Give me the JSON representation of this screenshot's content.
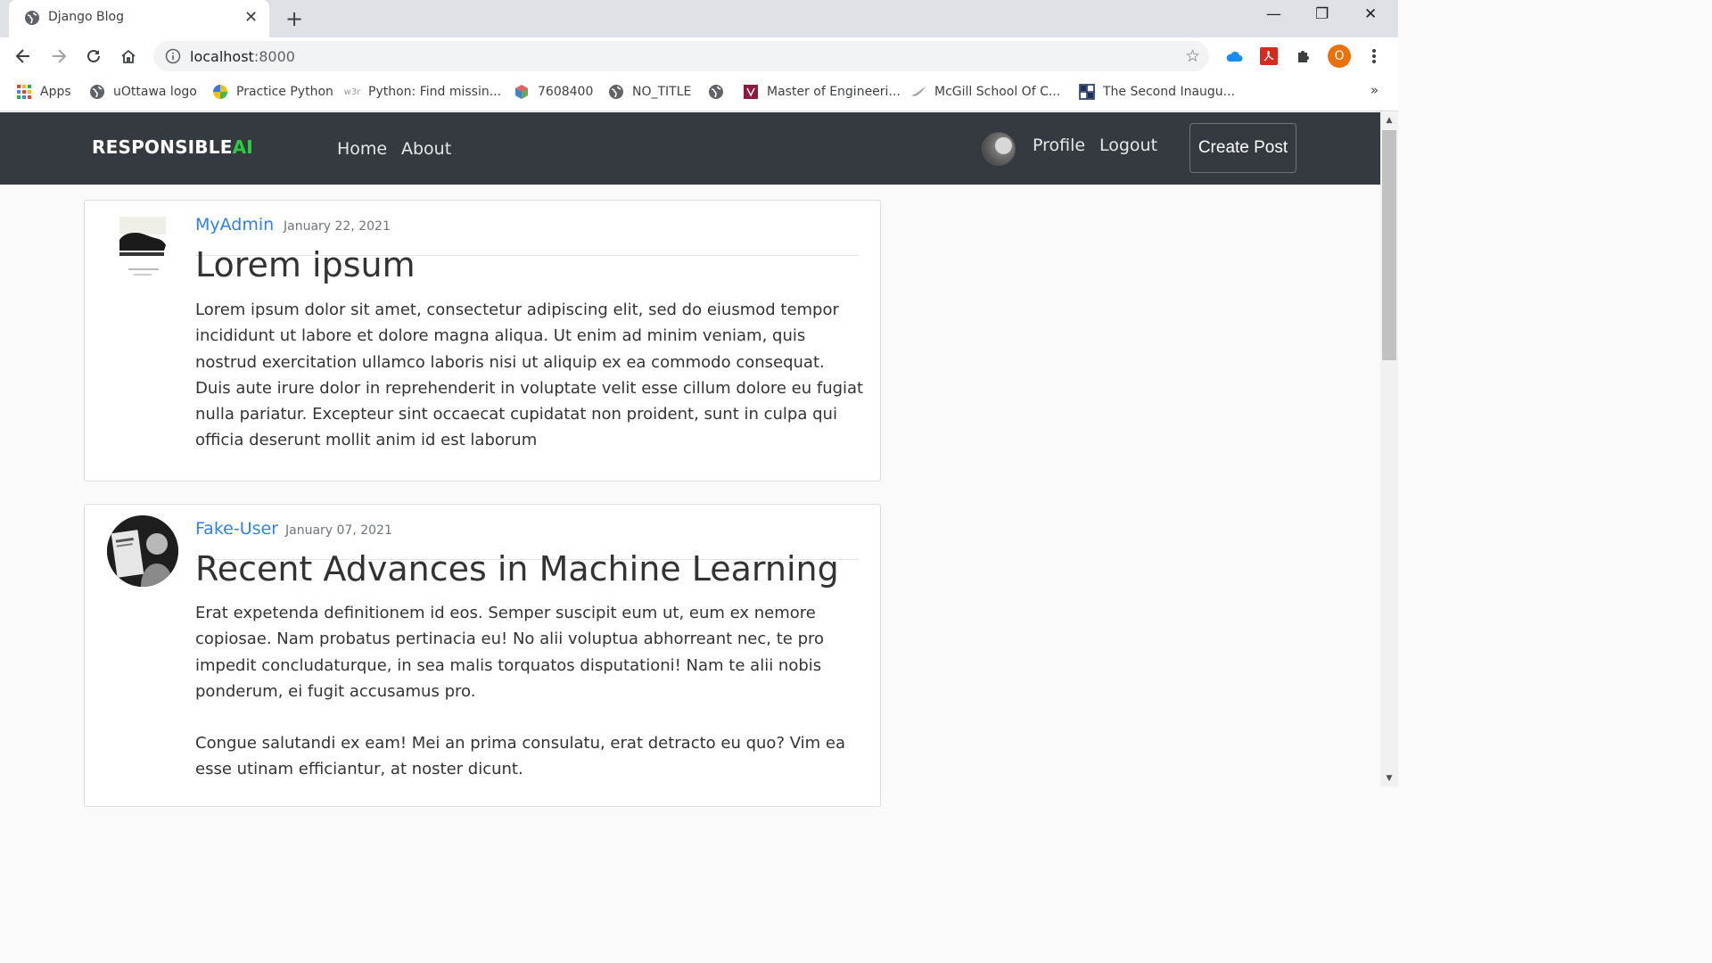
{
  "browser": {
    "tab_title": "Django Blog",
    "url_host": "localhost",
    "url_port": ":8000",
    "profile_initial": "O",
    "bookmarks": [
      {
        "label": "Apps",
        "icon": "apps-grid-icon"
      },
      {
        "label": "uOttawa logo",
        "icon": "globe-icon"
      },
      {
        "label": "Practice Python",
        "icon": "python-icon"
      },
      {
        "label": "Python: Find missin...",
        "icon": "w3schools-icon"
      },
      {
        "label": "7608400",
        "icon": "cube-icon"
      },
      {
        "label": "NO_TITLE",
        "icon": "globe-icon"
      },
      {
        "label": "",
        "icon": "globe-icon"
      },
      {
        "label": "Master of Engineeri...",
        "icon": "crest-icon"
      },
      {
        "label": "McGill School Of C...",
        "icon": "wing-icon"
      },
      {
        "label": "The Second Inaugu...",
        "icon": "grid-icon"
      }
    ],
    "bookmark_overflow": "»"
  },
  "site": {
    "brand_main": "RESPONSIBLE",
    "brand_accent": "AI",
    "nav_home": "Home",
    "nav_about": "About",
    "nav_profile": "Profile",
    "nav_logout": "Logout",
    "create_post": "Create Post"
  },
  "posts": [
    {
      "author": "MyAdmin",
      "date": "January 22, 2021",
      "title": "Lorem ipsum",
      "paragraphs": [
        "Lorem ipsum dolor sit amet, consectetur adipiscing elit, sed do eiusmod tempor incididunt ut labore et dolore magna aliqua. Ut enim ad minim veniam, quis nostrud exercitation ullamco laboris nisi ut aliquip ex ea commodo consequat. Duis aute irure dolor in reprehenderit in voluptate velit esse cillum dolore eu fugiat nulla pariatur. Excepteur sint occaecat cupidatat non proident, sunt in culpa qui officia deserunt mollit anim id est laborum"
      ]
    },
    {
      "author": "Fake-User",
      "date": "January 07, 2021",
      "title": "Recent Advances in Machine Learning",
      "paragraphs": [
        "Erat expetenda definitionem id eos. Semper suscipit eum ut, eum ex nemore copiosae. Nam probatus pertinacia eu! No alii voluptua abhorreant nec, te pro impedit concludaturque, in sea malis torquatos disputationi! Nam te alii nobis ponderum, ei fugit accusamus pro.",
        "Congue salutandi ex eam! Mei an prima consulatu, erat detracto eu quo? Vim ea esse utinam efficiantur, at noster dicunt."
      ]
    }
  ],
  "colors": {
    "navbar": "#343a40",
    "brand_accent": "#2ecc40",
    "author_link": "#2f80ed"
  }
}
